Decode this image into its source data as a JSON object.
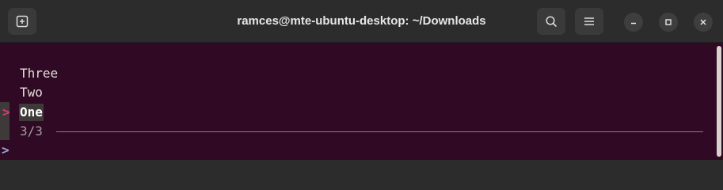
{
  "window": {
    "title": "ramces@mte-ubuntu-desktop: ~/Downloads"
  },
  "titlebar": {
    "icons": {
      "new_tab": "new-tab-icon",
      "search": "search-icon",
      "menu": "hamburger-menu-icon",
      "minimize": "minimize-icon",
      "maximize": "maximize-icon",
      "close": "close-icon"
    }
  },
  "terminal": {
    "items": [
      "Three",
      "Two",
      "One"
    ],
    "selected_index": 2,
    "pointer": ">",
    "counter": "3/3",
    "prompt": ">",
    "query": ""
  },
  "colors": {
    "terminal_background": "#300a24",
    "titlebar_background": "#2c2c2c",
    "pointer": "#e33a6c",
    "prompt": "#9ba3d6",
    "selection_background": "#3f3a3a",
    "text": "#e0dcda",
    "counter": "#a39b9e"
  }
}
